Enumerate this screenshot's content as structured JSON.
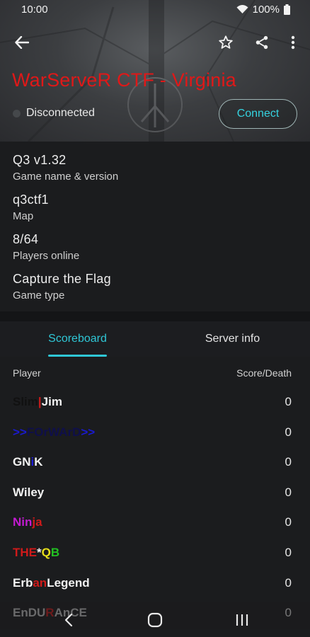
{
  "status_bar": {
    "time": "10:00",
    "battery": "100%"
  },
  "appbar": {
    "icons": [
      "back-arrow-icon",
      "star-icon",
      "share-icon",
      "more-vert-icon"
    ]
  },
  "server": {
    "title": "WarServeR CTF - Virginia",
    "connection_status": "Disconnected",
    "connect_label": "Connect"
  },
  "details": [
    {
      "value": "Q3 v1.32",
      "label": "Game name & version"
    },
    {
      "value": "q3ctf1",
      "label": "Map"
    },
    {
      "value": "8/64",
      "label": "Players online"
    },
    {
      "value": "Capture the Flag",
      "label": "Game type"
    }
  ],
  "tabs": {
    "scoreboard": "Scoreboard",
    "server_info": "Server info"
  },
  "scoreboard": {
    "col_player": "Player",
    "col_score": "Score/Death",
    "rows": [
      {
        "name": "Slim|Jim",
        "segments": [
          {
            "text": "Slim",
            "color": "#111111"
          },
          {
            "text": "|",
            "color": "#d01a1a"
          },
          {
            "text": "Jim",
            "color": "#f2f2f2"
          }
        ],
        "score": "0"
      },
      {
        "name": ">>FOrWArD>>",
        "segments": [
          {
            "text": ">>",
            "color": "#1a1ad0"
          },
          {
            "text": "FOrWArD",
            "color": "#0f0f4a"
          },
          {
            "text": ">>",
            "color": "#1a1ad0"
          }
        ],
        "score": "0"
      },
      {
        "name": "GNiK",
        "segments": [
          {
            "text": "GN",
            "color": "#f2f2f2"
          },
          {
            "text": "i",
            "color": "#1a1ad0"
          },
          {
            "text": "K",
            "color": "#f2f2f2"
          }
        ],
        "score": "0"
      },
      {
        "name": "Wiley",
        "segments": [
          {
            "text": "Wiley",
            "color": "#f2f2f2"
          }
        ],
        "score": "0"
      },
      {
        "name": "Ninja",
        "segments": [
          {
            "text": "Nin",
            "color": "#c21bd0"
          },
          {
            "text": "ja",
            "color": "#d01a1a"
          }
        ],
        "score": "0"
      },
      {
        "name": "THE*QB",
        "segments": [
          {
            "text": "THE",
            "color": "#d01a1a"
          },
          {
            "text": "*",
            "color": "#f2f2f2"
          },
          {
            "text": "Q",
            "color": "#e8e01a"
          },
          {
            "text": "B",
            "color": "#22c022"
          }
        ],
        "score": "0"
      },
      {
        "name": "ErbanLegend",
        "segments": [
          {
            "text": "Erb",
            "color": "#f2f2f2"
          },
          {
            "text": "an",
            "color": "#d01a1a"
          },
          {
            "text": "Legend",
            "color": "#f2f2f2"
          }
        ],
        "score": "0"
      },
      {
        "name": "EnDURAnCE",
        "segments": [
          {
            "text": "EnDU",
            "color": "#c8c8c8"
          },
          {
            "text": "R",
            "color": "#d01a1a"
          },
          {
            "text": "AnCE",
            "color": "#c8c8c8"
          }
        ],
        "score": "0"
      }
    ]
  },
  "navbar": {
    "icons": [
      "back-icon",
      "home-icon",
      "recents-icon"
    ]
  },
  "colors": {
    "accent": "#2fc7d6",
    "title": "#e01818",
    "background": "#1b1c1e"
  }
}
